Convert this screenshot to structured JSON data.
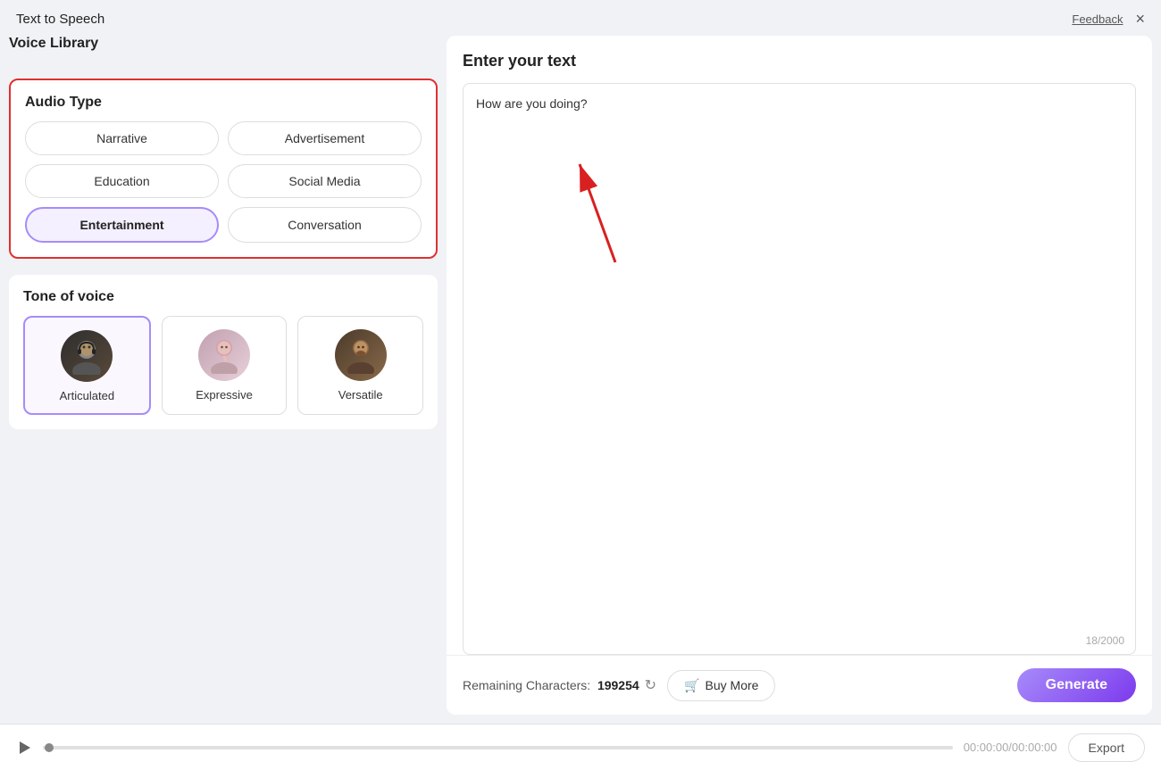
{
  "app": {
    "title": "Text to Speech",
    "feedback_label": "Feedback",
    "close_label": "×"
  },
  "left_panel": {
    "voice_library_title": "Voice Library",
    "audio_type_section": {
      "title": "Audio Type",
      "buttons": [
        {
          "id": "narrative",
          "label": "Narrative",
          "selected": false
        },
        {
          "id": "advertisement",
          "label": "Advertisement",
          "selected": false
        },
        {
          "id": "education",
          "label": "Education",
          "selected": false
        },
        {
          "id": "social_media",
          "label": "Social Media",
          "selected": false
        },
        {
          "id": "entertainment",
          "label": "Entertainment",
          "selected": true
        },
        {
          "id": "conversation",
          "label": "Conversation",
          "selected": false
        }
      ]
    },
    "tone_section": {
      "title": "Tone of voice",
      "tones": [
        {
          "id": "articulated",
          "label": "Articulated",
          "selected": true,
          "avatar_class": "articulated",
          "icon": "🎧"
        },
        {
          "id": "expressive",
          "label": "Expressive",
          "selected": false,
          "avatar_class": "expressive",
          "icon": "🎤"
        },
        {
          "id": "versatile",
          "label": "Versatile",
          "selected": false,
          "avatar_class": "versatile",
          "icon": "👤"
        }
      ]
    }
  },
  "right_panel": {
    "title": "Enter your text",
    "text_content": "How are you doing?",
    "char_count": "18/2000",
    "remaining_chars_label": "Remaining Characters:",
    "remaining_chars_value": "199254",
    "buy_more_label": "Buy More",
    "generate_label": "Generate",
    "refresh_icon": "↻",
    "cart_icon": "🛒"
  },
  "playback": {
    "time_display": "00:00:00/00:00:00",
    "export_label": "Export"
  }
}
